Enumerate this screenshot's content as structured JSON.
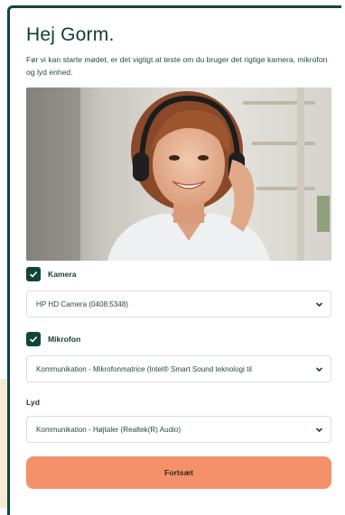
{
  "greeting": "Hej Gorm.",
  "intro": "Før vi kan starte mødet, er det vigtigt at teste om du bruger det rigtige kamera, mikrofon og lyd enhed.",
  "camera": {
    "label": "Kamera",
    "checked": true,
    "selected": "HP HD Camera (0408:5348)"
  },
  "microphone": {
    "label": "Mikrofon",
    "checked": true,
    "selected": "Kommunikation - Mikrofonmatrice (Intel® Smart Sound teknologi til"
  },
  "audio": {
    "label": "Lyd",
    "selected": "Kommunikation - Højtaler (Realtek(R) Audio)"
  },
  "continue_label": "Fortsæt",
  "colors": {
    "primary_dark": "#10463a",
    "accent": "#f4906a"
  }
}
